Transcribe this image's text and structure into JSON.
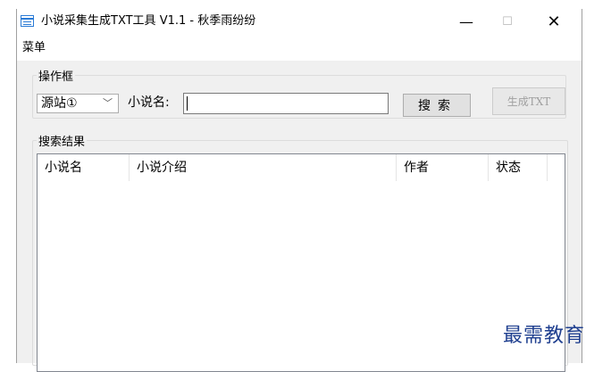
{
  "window": {
    "title": "小说采集生成TXT工具 V1.1 - 秋季雨纷纷",
    "minimize_glyph": "—",
    "maximize_glyph": "☐",
    "close_glyph": "✕",
    "icon": "window-app-icon"
  },
  "menubar": {
    "items": [
      {
        "label": "菜单"
      }
    ]
  },
  "ops_group": {
    "legend": "操作框",
    "source_select": {
      "selected": "源站①",
      "arrow": "﹀"
    },
    "search_label": "小说名:",
    "search_input": {
      "value": "",
      "placeholder": ""
    },
    "search_button": "搜索",
    "generate_button": "生成TXT"
  },
  "results_group": {
    "legend": "搜索结果",
    "columns": [
      {
        "label": "小说名"
      },
      {
        "label": "小说介绍"
      },
      {
        "label": "作者"
      },
      {
        "label": "状态"
      }
    ],
    "rows": []
  },
  "watermark": "最需教育",
  "colors": {
    "accent": "#2b7bd6",
    "watermark": "#1f3f8f",
    "disabled_text": "#a0a0a0"
  }
}
